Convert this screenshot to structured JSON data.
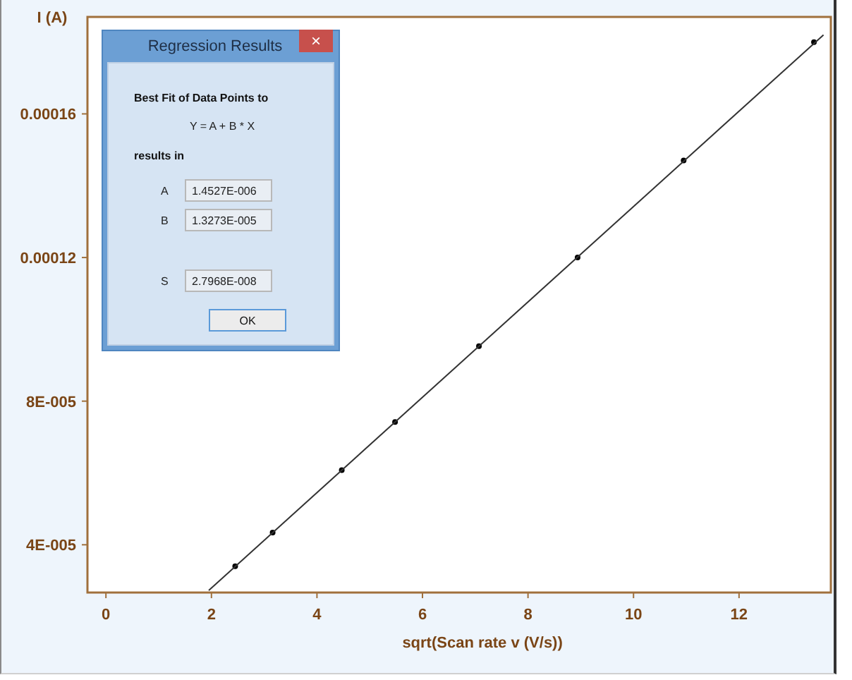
{
  "chart": {
    "chart_data": {
      "type": "scatter",
      "xlabel": "sqrt(Scan rate v (V/s))",
      "ylabel": "I (A)",
      "x": [
        1.95,
        2.45,
        3.16,
        4.47,
        5.48,
        7.07,
        8.94,
        10.95,
        13.42,
        13.6
      ],
      "series": [
        {
          "color": "#000000",
          "values": [
            null,
            3.4e-05,
            4.34e-05,
            6.08e-05,
            7.42e-05,
            9.53e-05,
            0.00012,
            0.000147,
            0.00018,
            null
          ]
        },
        {
          "type": "line",
          "color": "#333333",
          "values": [
            2.73e-05,
            null,
            null,
            null,
            null,
            null,
            null,
            null,
            null,
            0.000182
          ]
        }
      ],
      "xlim": [
        -0.35,
        13.74
      ],
      "ylim": [
        2.67e-05,
        0.000187
      ],
      "xticks": [
        0,
        2,
        4,
        6,
        8,
        10,
        12
      ],
      "yticks": [
        {
          "value": 4e-05,
          "label": "4E-005"
        },
        {
          "value": 8e-05,
          "label": "8E-005"
        },
        {
          "value": 0.00012,
          "label": "0.00012"
        },
        {
          "value": 0.00016,
          "label": "0.00016"
        }
      ]
    }
  },
  "dialog": {
    "title": "Regression Results",
    "close": "×",
    "heading": "Best Fit of Data Points  to",
    "equation": "Y = A + B * X",
    "subheading": "results in",
    "results": [
      {
        "label": "A",
        "value": "1.4527E-006"
      },
      {
        "label": "B",
        "value": "1.3273E-005"
      }
    ],
    "statistic": {
      "label": "S",
      "value": "2.7968E-008"
    },
    "button": "OK"
  }
}
